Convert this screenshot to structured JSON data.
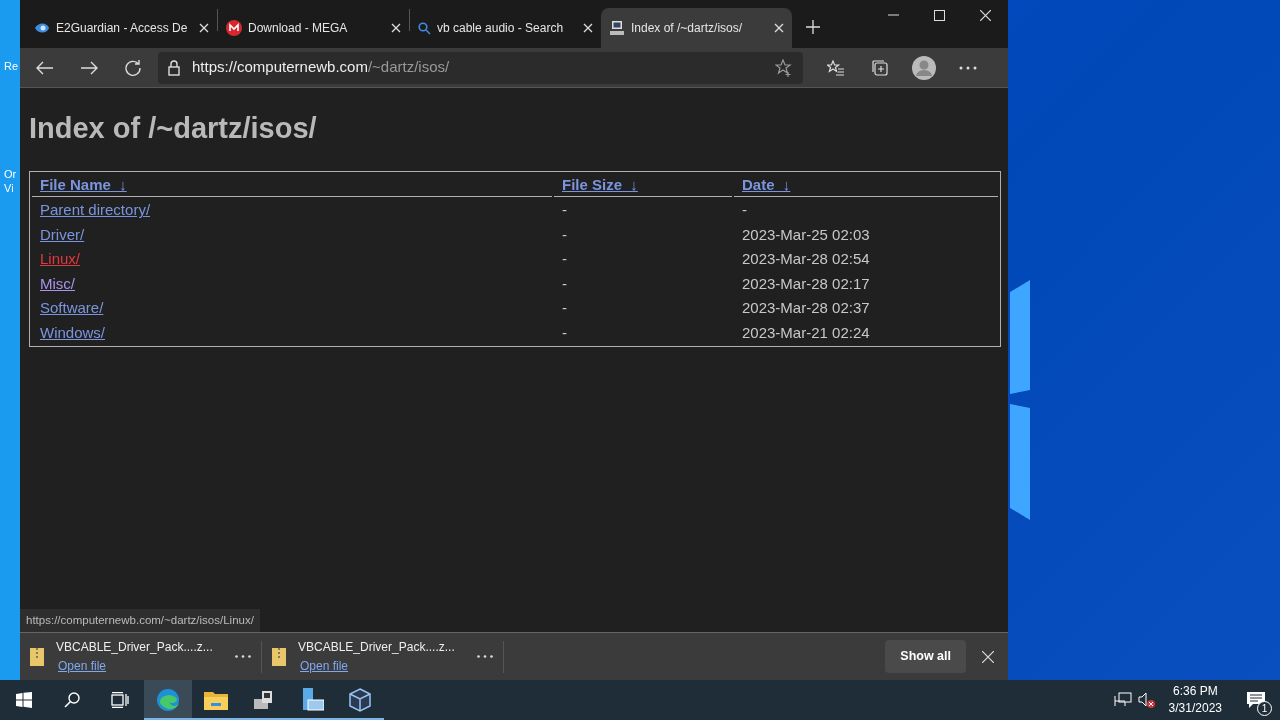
{
  "desktop": {
    "icon_labels": [
      "Re",
      "Or",
      "Vi"
    ]
  },
  "browser": {
    "tabs": [
      {
        "title": "E2Guardian - Access De",
        "kind": "shield",
        "selected": false
      },
      {
        "title": "Download - MEGA",
        "kind": "mega",
        "selected": false
      },
      {
        "title": "vb cable audio - Search",
        "kind": "search",
        "selected": false
      },
      {
        "title": "Index of /~dartz/isos/",
        "kind": "computer",
        "selected": true
      }
    ],
    "address": {
      "host": "https://computernewb.com",
      "path": "/~dartz/isos/"
    },
    "page": {
      "heading": "Index of /~dartz/isos/",
      "columns": [
        {
          "label": "File Name",
          "sort": "↓"
        },
        {
          "label": "File Size",
          "sort": "↓"
        },
        {
          "label": "Date",
          "sort": "↓"
        }
      ],
      "rows": [
        {
          "name": "Parent directory/",
          "hovered": false,
          "visited": false,
          "size": "-",
          "date": "-"
        },
        {
          "name": "Driver/",
          "hovered": false,
          "visited": false,
          "size": "-",
          "date": "2023-Mar-25 02:03"
        },
        {
          "name": "Linux/",
          "hovered": true,
          "visited": false,
          "size": "-",
          "date": "2023-Mar-28 02:54"
        },
        {
          "name": "Misc/",
          "hovered": false,
          "visited": true,
          "size": "-",
          "date": "2023-Mar-28 02:17"
        },
        {
          "name": "Software/",
          "hovered": false,
          "visited": false,
          "size": "-",
          "date": "2023-Mar-28 02:37"
        },
        {
          "name": "Windows/",
          "hovered": false,
          "visited": false,
          "size": "-",
          "date": "2023-Mar-21 02:24"
        }
      ]
    },
    "status_url": "https://computernewb.com/~dartz/isos/Linux/",
    "downloads": [
      {
        "file": "VBCABLE_Driver_Pack....z...",
        "action": "Open file"
      },
      {
        "file": "VBCABLE_Driver_Pack....z...",
        "action": "Open file"
      }
    ],
    "show_all": "Show all"
  },
  "taskbar": {
    "apps": [
      {
        "kind": "edge",
        "active": true
      },
      {
        "kind": "folder",
        "active": false
      },
      {
        "kind": "network",
        "active": false
      },
      {
        "kind": "server",
        "active": false
      },
      {
        "kind": "cube",
        "active": false
      }
    ],
    "time": "6:36 PM",
    "date": "3/31/2023",
    "notifications": "1"
  }
}
